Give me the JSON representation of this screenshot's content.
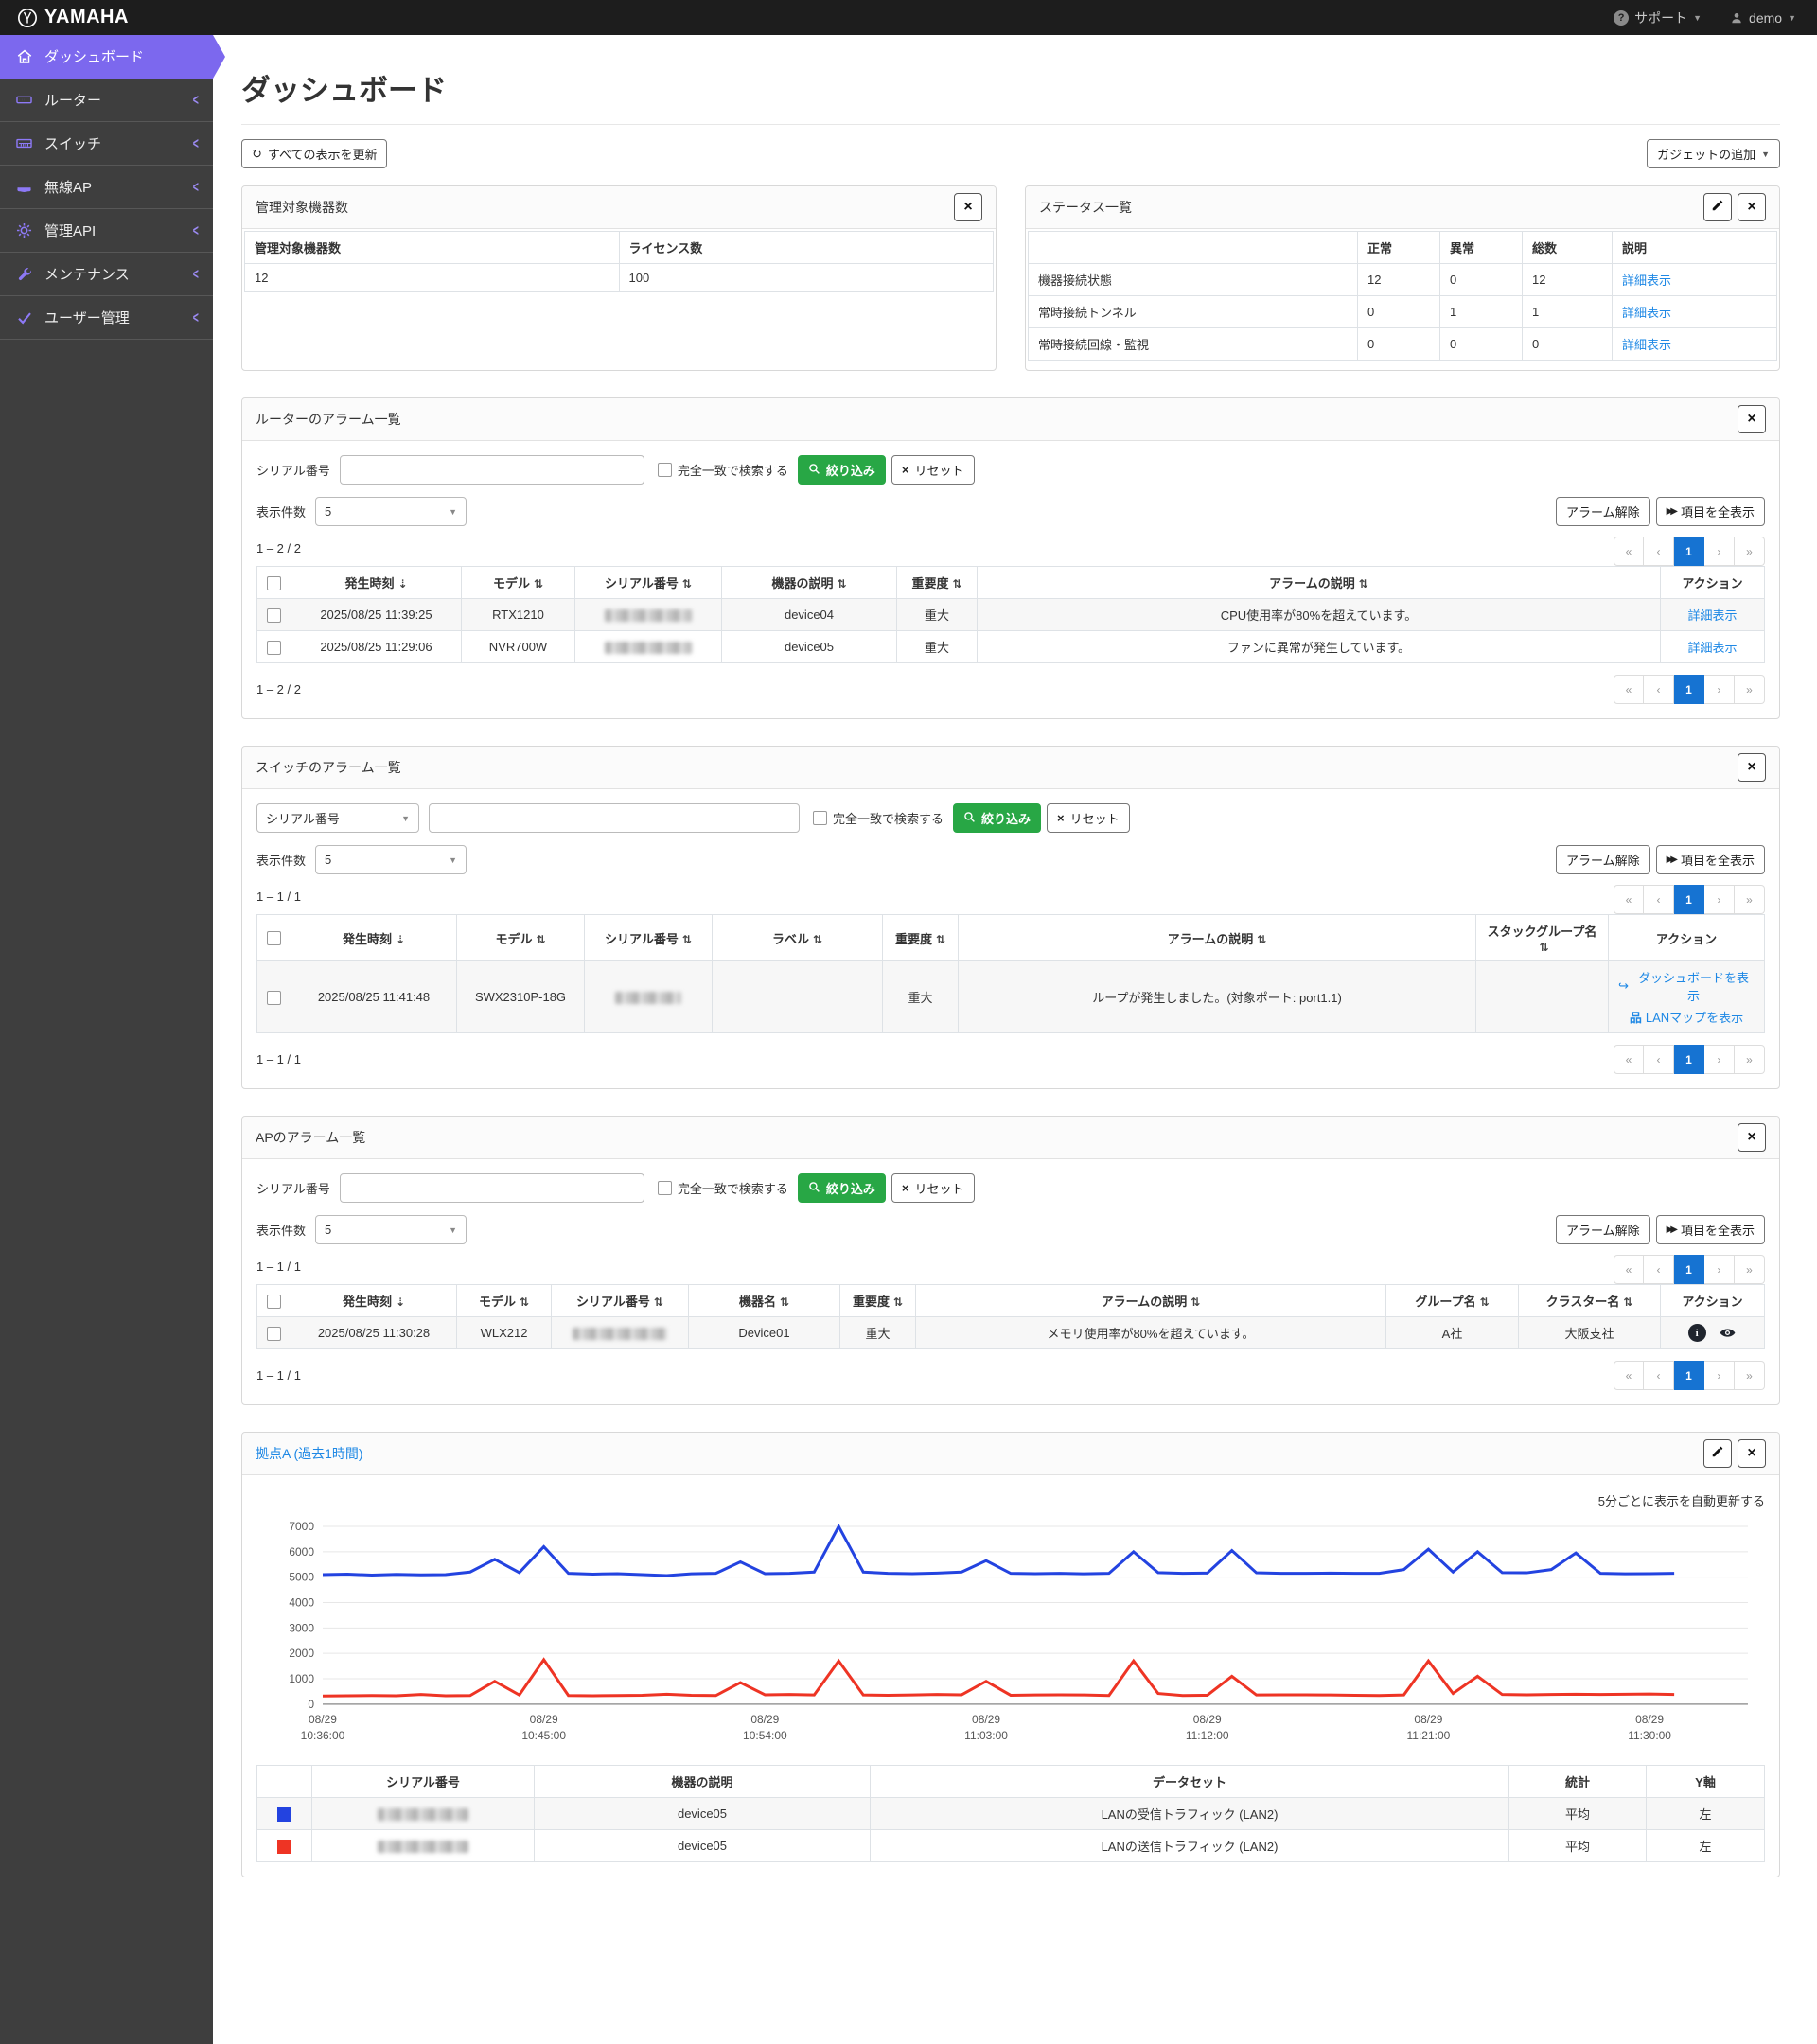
{
  "topbar": {
    "brand": "YAMAHA",
    "support": "サポート",
    "user": "demo"
  },
  "sidebar": {
    "items": [
      {
        "label": "ダッシュボード",
        "icon": "home-icon",
        "active": true
      },
      {
        "label": "ルーター",
        "icon": "router-icon",
        "active": false
      },
      {
        "label": "スイッチ",
        "icon": "switch-icon",
        "active": false
      },
      {
        "label": "無線AP",
        "icon": "access-point-icon",
        "active": false
      },
      {
        "label": "管理API",
        "icon": "gear-icon",
        "active": false
      },
      {
        "label": "メンテナンス",
        "icon": "wrench-icon",
        "active": false
      },
      {
        "label": "ユーザー管理",
        "icon": "check-icon",
        "active": false
      }
    ]
  },
  "page": {
    "title": "ダッシュボード"
  },
  "toolbar": {
    "refresh_all": "すべての表示を更新",
    "add_gadget": "ガジェットの追加"
  },
  "filters": {
    "serial_label": "シリアル番号",
    "serial_select_value": "シリアル番号",
    "exact_match": "完全一致で検索する",
    "apply": "絞り込み",
    "reset": "リセット",
    "page_size_label": "表示件数",
    "page_size_value": "5",
    "clear_alarms": "アラーム解除",
    "show_all_columns": "項目を全表示"
  },
  "pagination": {
    "first": "«",
    "prev": "‹",
    "page": "1",
    "next": "›",
    "last": "»"
  },
  "device_count_widget": {
    "title": "管理対象機器数",
    "col_devices": "管理対象機器数",
    "col_licenses": "ライセンス数",
    "devices": "12",
    "licenses": "100"
  },
  "status_widget": {
    "title": "ステータス一覧",
    "col_normal": "正常",
    "col_error": "異常",
    "col_total": "総数",
    "col_desc": "説明",
    "detail_link": "詳細表示",
    "rows": [
      {
        "label": "機器接続状態",
        "normal": "12",
        "error": "0",
        "total": "12"
      },
      {
        "label": "常時接続トンネル",
        "normal": "0",
        "error": "1",
        "total": "1"
      },
      {
        "label": "常時接続回線・監視",
        "normal": "0",
        "error": "0",
        "total": "0"
      }
    ]
  },
  "router_alarms": {
    "title": "ルーターのアラーム一覧",
    "count": "1 – 2 / 2",
    "columns": {
      "time": "発生時刻",
      "model": "モデル",
      "serial": "シリアル番号",
      "description": "機器の説明",
      "severity": "重要度",
      "alarm": "アラームの説明",
      "action": "アクション"
    },
    "rows": [
      {
        "time": "2025/08/25 11:39:25",
        "model": "RTX1210",
        "description": "device04",
        "severity": "重大",
        "alarm": "CPU使用率が80%を超えています。",
        "action": "詳細表示"
      },
      {
        "time": "2025/08/25 11:29:06",
        "model": "NVR700W",
        "description": "device05",
        "severity": "重大",
        "alarm": "ファンに異常が発生しています。",
        "action": "詳細表示"
      }
    ]
  },
  "switch_alarms": {
    "title": "スイッチのアラーム一覧",
    "count": "1 – 1 / 1",
    "columns": {
      "time": "発生時刻",
      "model": "モデル",
      "serial": "シリアル番号",
      "label": "ラベル",
      "severity": "重要度",
      "alarm": "アラームの説明",
      "stack_group": "スタックグループ名",
      "action": "アクション"
    },
    "rows": [
      {
        "time": "2025/08/25 11:41:48",
        "model": "SWX2310P-18G",
        "label": "",
        "severity": "重大",
        "alarm": "ループが発生しました。(対象ポート: port1.1)",
        "stack_group": "",
        "action_dashboard": "ダッシュボードを表示",
        "action_lanmap": "LANマップを表示"
      }
    ]
  },
  "ap_alarms": {
    "title": "APのアラーム一覧",
    "count": "1 – 1 / 1",
    "columns": {
      "time": "発生時刻",
      "model": "モデル",
      "serial": "シリアル番号",
      "device_name": "機器名",
      "severity": "重要度",
      "alarm": "アラームの説明",
      "group": "グループ名",
      "cluster": "クラスター名",
      "action": "アクション"
    },
    "rows": [
      {
        "time": "2025/08/25 11:30:28",
        "model": "WLX212",
        "device_name": "Device01",
        "severity": "重大",
        "alarm": "メモリ使用率が80%を超えています。",
        "group": "A社",
        "cluster": "大阪支社"
      }
    ]
  },
  "site_widget": {
    "title": "拠点A (過去1時間)",
    "auto_refresh_note": "5分ごとに表示を自動更新する",
    "legend_columns": {
      "serial": "シリアル番号",
      "description": "機器の説明",
      "dataset": "データセット",
      "stat": "統計",
      "axis": "Y軸"
    },
    "legend_rows": [
      {
        "description": "device05",
        "dataset": "LANの受信トラフィック (LAN2)",
        "stat": "平均",
        "axis": "左"
      },
      {
        "description": "device05",
        "dataset": "LANの送信トラフィック (LAN2)",
        "stat": "平均",
        "axis": "左"
      }
    ]
  },
  "chart_data": {
    "type": "line",
    "title": "拠点A (過去1時間)",
    "x_start": "08/29 10:36:00",
    "x_interval_minutes": 1,
    "x_domain_minutes": [
      0,
      58
    ],
    "x_tick_minutes": [
      0,
      9,
      18,
      27,
      36,
      45,
      54
    ],
    "x_tick_labels": [
      [
        "08/29",
        "10:36:00"
      ],
      [
        "08/29",
        "10:45:00"
      ],
      [
        "08/29",
        "10:54:00"
      ],
      [
        "08/29",
        "11:03:00"
      ],
      [
        "08/29",
        "11:12:00"
      ],
      [
        "08/29",
        "11:21:00"
      ],
      [
        "08/29",
        "11:30:00"
      ]
    ],
    "ylim": [
      0,
      7000
    ],
    "y_ticks": [
      0,
      1000,
      2000,
      3000,
      4000,
      5000,
      6000,
      7000
    ],
    "grid": true,
    "legend_position": "bottom-table",
    "series": [
      {
        "name": "LANの受信トラフィック (LAN2)",
        "color": "#2343e0",
        "values": [
          5100,
          5120,
          5080,
          5110,
          5090,
          5100,
          5200,
          5700,
          5180,
          6200,
          5150,
          5120,
          5140,
          5100,
          5060,
          5130,
          5150,
          5600,
          5140,
          5150,
          5200,
          7000,
          5200,
          5150,
          5140,
          5160,
          5200,
          5650,
          5150,
          5140,
          5150,
          5130,
          5150,
          6000,
          5180,
          5150,
          5160,
          6050,
          5170,
          5150,
          5150,
          5160,
          5150,
          5150,
          5300,
          6100,
          5200,
          6000,
          5180,
          5170,
          5300,
          5950,
          5150,
          5130,
          5140,
          5150
        ]
      },
      {
        "name": "LANの送信トラフィック (LAN2)",
        "color": "#ee3424",
        "values": [
          320,
          330,
          340,
          330,
          380,
          330,
          340,
          900,
          360,
          1750,
          340,
          330,
          340,
          350,
          390,
          350,
          340,
          850,
          370,
          380,
          360,
          1700,
          360,
          350,
          360,
          380,
          370,
          900,
          350,
          360,
          370,
          360,
          340,
          1700,
          420,
          340,
          350,
          1100,
          360,
          370,
          370,
          360,
          350,
          340,
          360,
          1700,
          420,
          1100,
          380,
          370,
          380,
          390,
          380,
          390,
          400,
          380
        ]
      }
    ]
  }
}
